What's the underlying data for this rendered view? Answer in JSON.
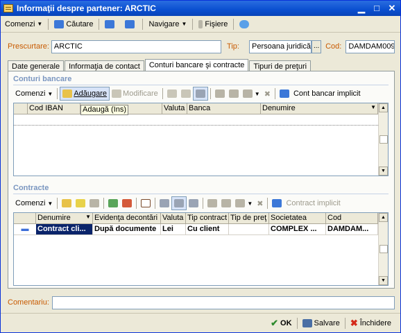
{
  "window": {
    "title": "Informaţii despre partener: ARCTIC"
  },
  "menubar": {
    "comenzi": "Comenzi",
    "cautare": "Căutare",
    "navigare": "Navigare",
    "fisiere": "Fişiere"
  },
  "header": {
    "prescurtare_label": "Prescurtare:",
    "prescurtare_value": "ARCTIC",
    "tip_label": "Tip:",
    "tip_value": "Persoana juridică",
    "tip_button": "...",
    "cod_label": "Cod:",
    "cod_value": "DAMDAM009"
  },
  "tabs": [
    {
      "label": "Date generale"
    },
    {
      "label": "Informaţia de contact"
    },
    {
      "label": "Conturi bancare şi contracte"
    },
    {
      "label": "Tipuri de preţuri"
    }
  ],
  "conturi": {
    "title": "Conturi bancare",
    "toolbar": {
      "comenzi": "Comenzi",
      "adaugare": "Adăugare",
      "modificare": "Modificare",
      "implicit": "Cont bancar implicit"
    },
    "tooltip": "Adaugă (Ins)",
    "columns": [
      "Cod IBAN",
      "",
      "Valuta",
      "Banca",
      "Denumire"
    ],
    "rows": []
  },
  "contracte": {
    "title": "Contracte",
    "toolbar": {
      "comenzi": "Comenzi",
      "implicit": "Contract implicit"
    },
    "columns": [
      "Denumire",
      "Evidenţa decontări",
      "Valuta",
      "Tip contract",
      "Tip de preţ",
      "Societatea",
      "Cod"
    ],
    "rows": [
      [
        "Contract cli...",
        "După documente",
        "Lei",
        "Cu client",
        "",
        "COMPLEX ...",
        "DAMDAM..."
      ]
    ]
  },
  "footer": {
    "comentariu_label": "Comentariu:",
    "comentariu_value": "",
    "ok": "OK",
    "salvare": "Salvare",
    "inchidere": "Închidere"
  }
}
